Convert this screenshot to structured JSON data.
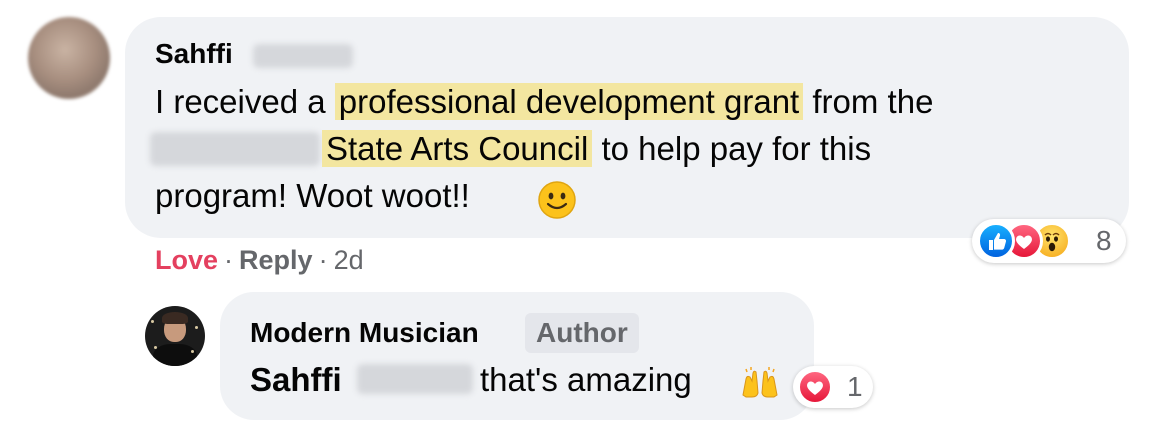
{
  "comment": {
    "author": "Sahffi",
    "lines": [
      {
        "before": "I received a ",
        "highlight": "professional development grant",
        "after": " from the"
      },
      {
        "highlight": "State Arts Council",
        "after": " to help pay for this"
      },
      {
        "text": "program! Woot woot!!"
      }
    ],
    "emoji": "slightly-smiling-face",
    "actions": {
      "love": "Love",
      "separator": "·",
      "reply": "Reply",
      "time": "2d"
    },
    "reactions": {
      "icons": [
        "like-icon",
        "love-icon",
        "wow-icon"
      ],
      "count": "8"
    }
  },
  "reply": {
    "author": "Modern Musician",
    "badge": "Author",
    "mention": "Sahffi",
    "text": "that's amazing",
    "emoji": "raising-hands",
    "reactions": {
      "icons": [
        "love-icon"
      ],
      "count": "1"
    }
  },
  "colors": {
    "bubble": "#f0f2f5",
    "highlight": "#f3e6a0",
    "love": "#e4405f",
    "muted": "#65676b",
    "like": "#1877f2"
  }
}
